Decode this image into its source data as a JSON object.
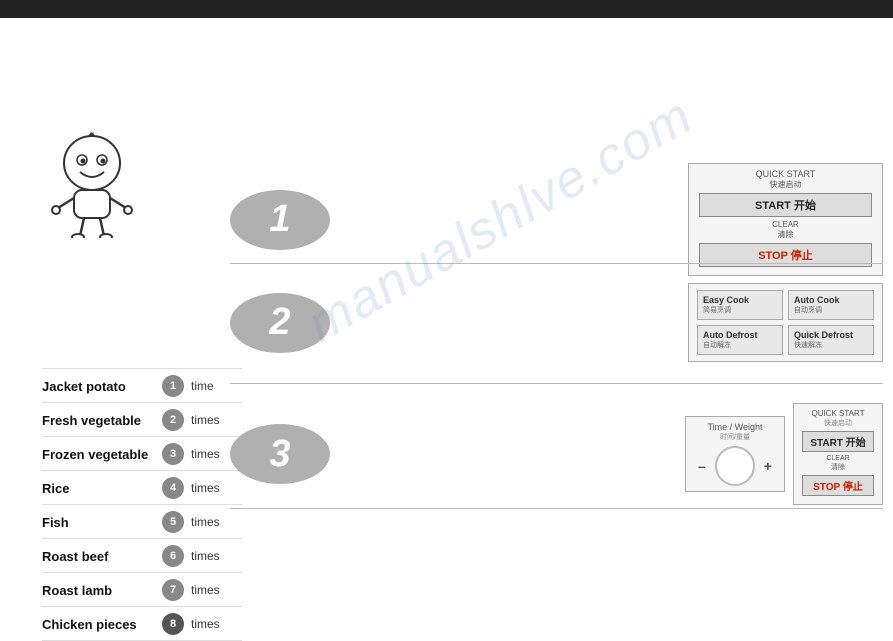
{
  "topBar": {
    "color": "#222"
  },
  "watermark": {
    "text": "manualshlve.com"
  },
  "sidebar": {
    "items": [
      {
        "id": 1,
        "label": "Jacket potato",
        "times": "time",
        "badgeBg": "#888"
      },
      {
        "id": 2,
        "label": "Fresh vegetable",
        "times": "times",
        "badgeBg": "#888"
      },
      {
        "id": 3,
        "label": "Frozen vegetable",
        "times": "times",
        "badgeBg": "#888"
      },
      {
        "id": 4,
        "label": "Rice",
        "times": "times",
        "badgeBg": "#888"
      },
      {
        "id": 5,
        "label": "Fish",
        "times": "times",
        "badgeBg": "#888"
      },
      {
        "id": 6,
        "label": "Roast beef",
        "times": "times",
        "badgeBg": "#888"
      },
      {
        "id": 7,
        "label": "Roast lamb",
        "times": "times",
        "badgeBg": "#888"
      },
      {
        "id": 8,
        "label": "Chicken pieces",
        "times": "times",
        "badgeBg": "#555"
      }
    ]
  },
  "steps": [
    {
      "number": "1"
    },
    {
      "number": "2"
    },
    {
      "number": "3"
    }
  ],
  "panel1": {
    "quickStartLabel": "QUICK START",
    "quickStartSub": "快速启动",
    "startLabel": "START 开始",
    "clearLabel": "CLEAR",
    "clearSub": "清除",
    "stopLabel": "STOP 停止"
  },
  "panel2": {
    "cells": [
      {
        "label": "Easy Cook",
        "sub": "简易烹调"
      },
      {
        "label": "Auto Cook",
        "sub": "自动烹调"
      },
      {
        "label": "Auto Defrost",
        "sub": "自动解冻"
      },
      {
        "label": "Quick Defrost",
        "sub": "快速解冻"
      }
    ]
  },
  "panel3": {
    "timeLabel": "Time / Weight",
    "timeSub": "时间/重量",
    "minusLabel": "–",
    "plusLabel": "+",
    "quickStartLabel": "QUICK START",
    "quickStartSub": "快速启动",
    "startLabel": "START 开始",
    "clearLabel": "CLEAR",
    "clearSub": "清除",
    "stopLabel": "STOP 停止"
  }
}
